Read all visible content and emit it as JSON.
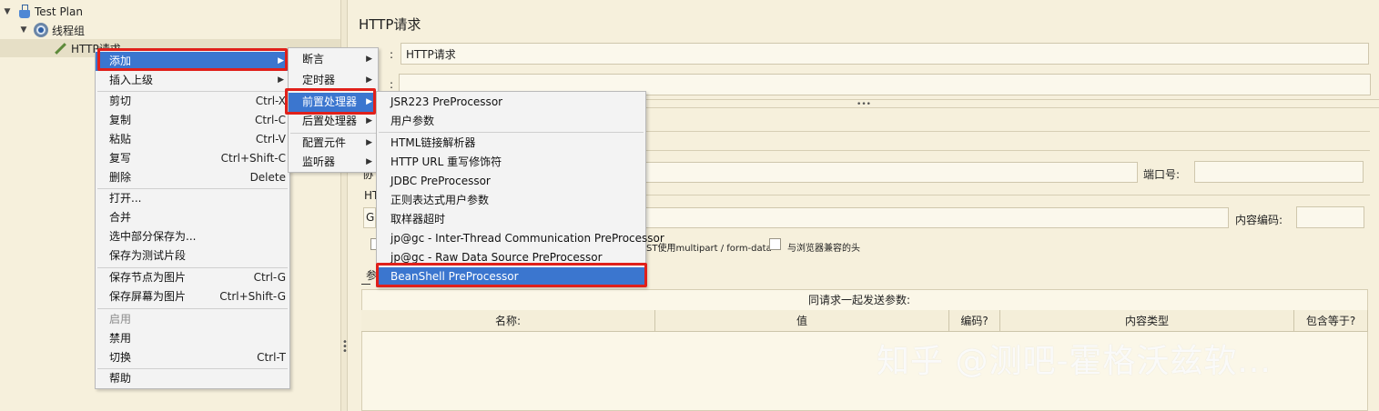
{
  "tree": {
    "test_plan": "Test Plan",
    "thread_group": "线程组",
    "http_request": "HTTP请求"
  },
  "editor": {
    "title": "HTTP请求",
    "name_value": "HTTP请求",
    "comment_value": "",
    "label_name_suffix": ":",
    "label_comment_suffix": ":",
    "protocol_partial": "协",
    "port_label": "端口号:",
    "http_partial": "HT",
    "method_partial": "G",
    "encoding_label": "内容编码:",
    "multipart_partial": "ST使用multipart / form-data",
    "browser_headers": "与浏览器兼容的头",
    "params_tab_partial": "参",
    "params_caption": "同请求一起发送参数:",
    "columns": [
      "名称:",
      "值",
      "编码?",
      "内容类型",
      "包含等于?"
    ]
  },
  "watermark": "知乎 @测吧-霍格沃兹软...",
  "menu1": {
    "items": [
      {
        "label": "添加",
        "submenu": true
      },
      {
        "label": "插入上级",
        "submenu": true
      },
      {
        "label": "剪切",
        "shortcut": "Ctrl-X"
      },
      {
        "label": "复制",
        "shortcut": "Ctrl-C"
      },
      {
        "label": "粘贴",
        "shortcut": "Ctrl-V"
      },
      {
        "label": "复写",
        "shortcut": "Ctrl+Shift-C"
      },
      {
        "label": "删除",
        "shortcut": "Delete"
      },
      {
        "label": "打开..."
      },
      {
        "label": "合并"
      },
      {
        "label": "选中部分保存为..."
      },
      {
        "label": "保存为测试片段"
      },
      {
        "label": "保存节点为图片",
        "shortcut": "Ctrl-G"
      },
      {
        "label": "保存屏幕为图片",
        "shortcut": "Ctrl+Shift-G"
      },
      {
        "label": "启用"
      },
      {
        "label": "禁用"
      },
      {
        "label": "切换",
        "shortcut": "Ctrl-T"
      },
      {
        "label": "帮助"
      }
    ]
  },
  "menu2": {
    "items": [
      {
        "label": "断言"
      },
      {
        "label": "定时器"
      },
      {
        "label": "前置处理器"
      },
      {
        "label": "后置处理器"
      },
      {
        "label": "配置元件"
      },
      {
        "label": "监听器"
      }
    ]
  },
  "menu3": {
    "items": [
      {
        "label": "JSR223 PreProcessor"
      },
      {
        "label": "用户参数"
      },
      {
        "label": "HTML链接解析器"
      },
      {
        "label": "HTTP URL 重写修饰符"
      },
      {
        "label": "JDBC PreProcessor"
      },
      {
        "label": "正则表达式用户参数"
      },
      {
        "label": "取样器超时"
      },
      {
        "label": "jp@gc - Inter-Thread Communication PreProcessor"
      },
      {
        "label": "jp@gc - Raw Data Source PreProcessor"
      },
      {
        "label": "BeanShell PreProcessor"
      }
    ]
  },
  "colors": {
    "highlight": "#3b76cf",
    "annotation_red": "#e0201a",
    "background": "#f6f0dc"
  }
}
